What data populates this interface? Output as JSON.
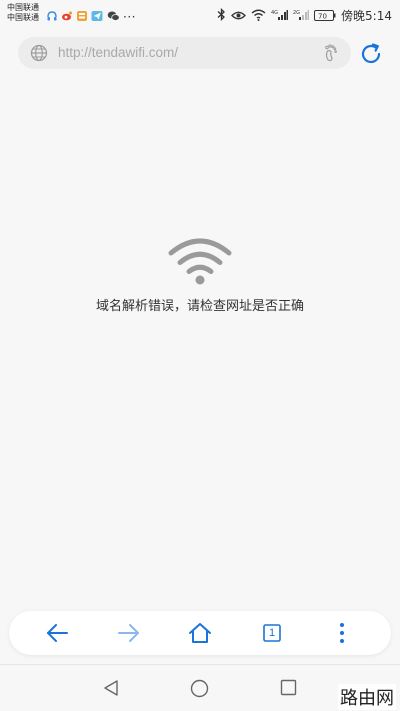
{
  "status_bar": {
    "carrier_1": "中国联通",
    "carrier_2": "中国联通",
    "more": "···",
    "network_badge": "4G",
    "battery": "70",
    "time": "傍晚5:14"
  },
  "address_bar": {
    "url": "http://tendawifi.com/"
  },
  "error": {
    "message": "域名解析错误，请检查网址是否正确"
  },
  "toolbar": {
    "tab_count": "1"
  },
  "watermark": {
    "text": "路由网"
  },
  "colors": {
    "accent": "#1a73d9",
    "background": "#f7f7f7",
    "url_box": "#ececec",
    "error_icon": "#9a9a9a"
  }
}
